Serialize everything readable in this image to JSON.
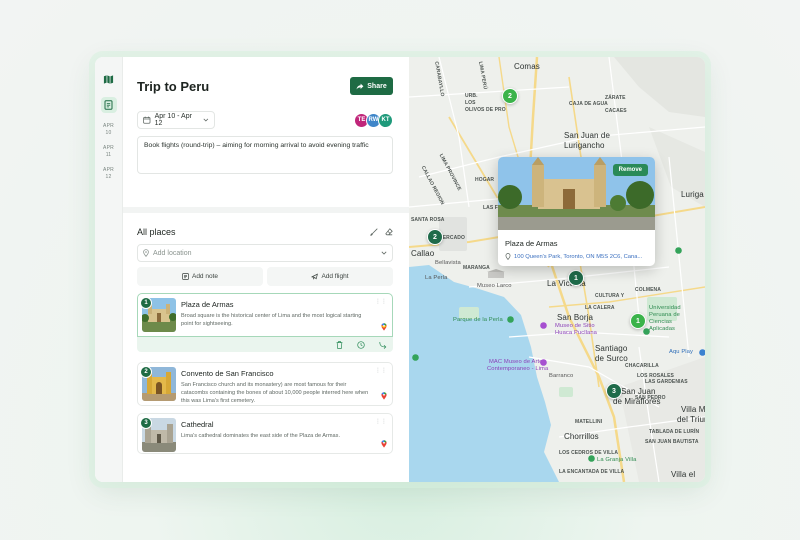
{
  "rail": {
    "dates": [
      [
        "APR",
        "10"
      ],
      [
        "APR",
        "11"
      ],
      [
        "APR",
        "12"
      ]
    ]
  },
  "trip": {
    "title": "Trip to Peru",
    "share_label": "Share",
    "date_range": "Apr 10 - Apr 12",
    "avatars": [
      {
        "initials": "TE",
        "color": "#c0267a"
      },
      {
        "initials": "RW",
        "color": "#3f86c9"
      },
      {
        "initials": "KT",
        "color": "#1f9a7b"
      }
    ],
    "note": "Book flights (round-trip) – aiming for morning arrival to avoid evening traffic"
  },
  "places": {
    "title": "All places",
    "location_placeholder": "Add location",
    "add_note_label": "Add note",
    "add_flight_label": "Add flight",
    "items": [
      {
        "num": "1",
        "name": "Plaza de Armas",
        "desc": "Broad square is the historical center of Lima and the most logical starting point for sightseeing."
      },
      {
        "num": "2",
        "name": "Convento de San Francisco",
        "desc": "San Francisco church and its monastery) are most famous for their catacombs containing the bones of about 10,000 people interred here when this was Lima's first cemetery."
      },
      {
        "num": "3",
        "name": "Cathedral",
        "desc": "Lima's cathedral dominates the east side of the Plaza de Armas."
      }
    ]
  },
  "map": {
    "labels": {
      "comas": "Comas",
      "san_juan": "San Juan de",
      "lurigancho": "Lurigancho",
      "callao": "Callao",
      "bellavista": "Bellavista",
      "la_perla": "La Perla",
      "museo_larco": "Museo Larco",
      "la_victoria": "La Victoria",
      "san_borja": "San Borja",
      "santiago": "Santiago",
      "de_surco": "de Surco",
      "barranco": "Barranco",
      "san_juan_m": "San Juan",
      "de_miraflores": "de Miraflores",
      "chorrillos": "Chorrillos",
      "villa_m": "Villa M",
      "del_triunfo": "del Triunfo",
      "villa_el": "Villa el",
      "luriga": "Luriga",
      "parque_perla": "Parque de la Perla",
      "museo_sitio": "Museo de Sitio",
      "huaca": "Huaca Pucllana",
      "mac": "MAC Museo de Arte",
      "contemporaneo": "Contemporaneo - Lima",
      "univ1": "Universidad",
      "univ2": "Peruana de",
      "univ3": "Ciencias",
      "univ4": "Aplicadas",
      "aqua": "Aqu Play",
      "la_granja": "La Granja Villa",
      "carabayllo1": "CARABAYLLO",
      "lima_peru": "LIMA PERÚ",
      "los_olivos1": "URB.",
      "los_olivos2": "LOS",
      "los_olivos3": "OLIVOS DE PRO",
      "zarate1": "ZÁRATE",
      "caja1": "CAJA DE AGUA",
      "cacaes": "CACAES",
      "lima_prov1": "LIMA PROVINCE",
      "callao_reg": "CALLAO REGION",
      "santa_rosa": "SANTA ROSA",
      "las_flores": "LAS FLORES",
      "hogar": "HOGAR",
      "cercado": "CERCADO",
      "maranga": "MARANGA",
      "la_calera": "LA CALERA",
      "cultura": "CULTURA Y",
      "colmena": "COLMENA",
      "los_rosales": "LOS ROSALES",
      "las_gardenias": "LAS GARDENIAS",
      "pedro": "SAN PEDRO",
      "tablada": "TABLADA DE LURÍN",
      "matellini": "MATELLINI",
      "encantada": "LA ENCANTADA DE VILLA",
      "los_cedros": "LOS CEDROS DE VILLA",
      "proceres": "SAN JUAN BAUTISTA",
      "chacarilla": "CHACARILLA"
    },
    "pins": [
      {
        "num": "2",
        "kind": "lime"
      },
      {
        "num": "2",
        "kind": "dark"
      },
      {
        "num": "1",
        "kind": "dark"
      },
      {
        "num": "1",
        "kind": "lime"
      },
      {
        "num": "3",
        "kind": "dark"
      }
    ],
    "popup": {
      "remove_label": "Remove",
      "title": "Plaza de Armas",
      "address": "100 Queen's Park, Toronto, ON M5S 2C6, Cana..."
    }
  },
  "colors": {
    "brand": "#1e6b44",
    "accent_light": "#eaf5ee",
    "water": "#a9d7ee"
  }
}
